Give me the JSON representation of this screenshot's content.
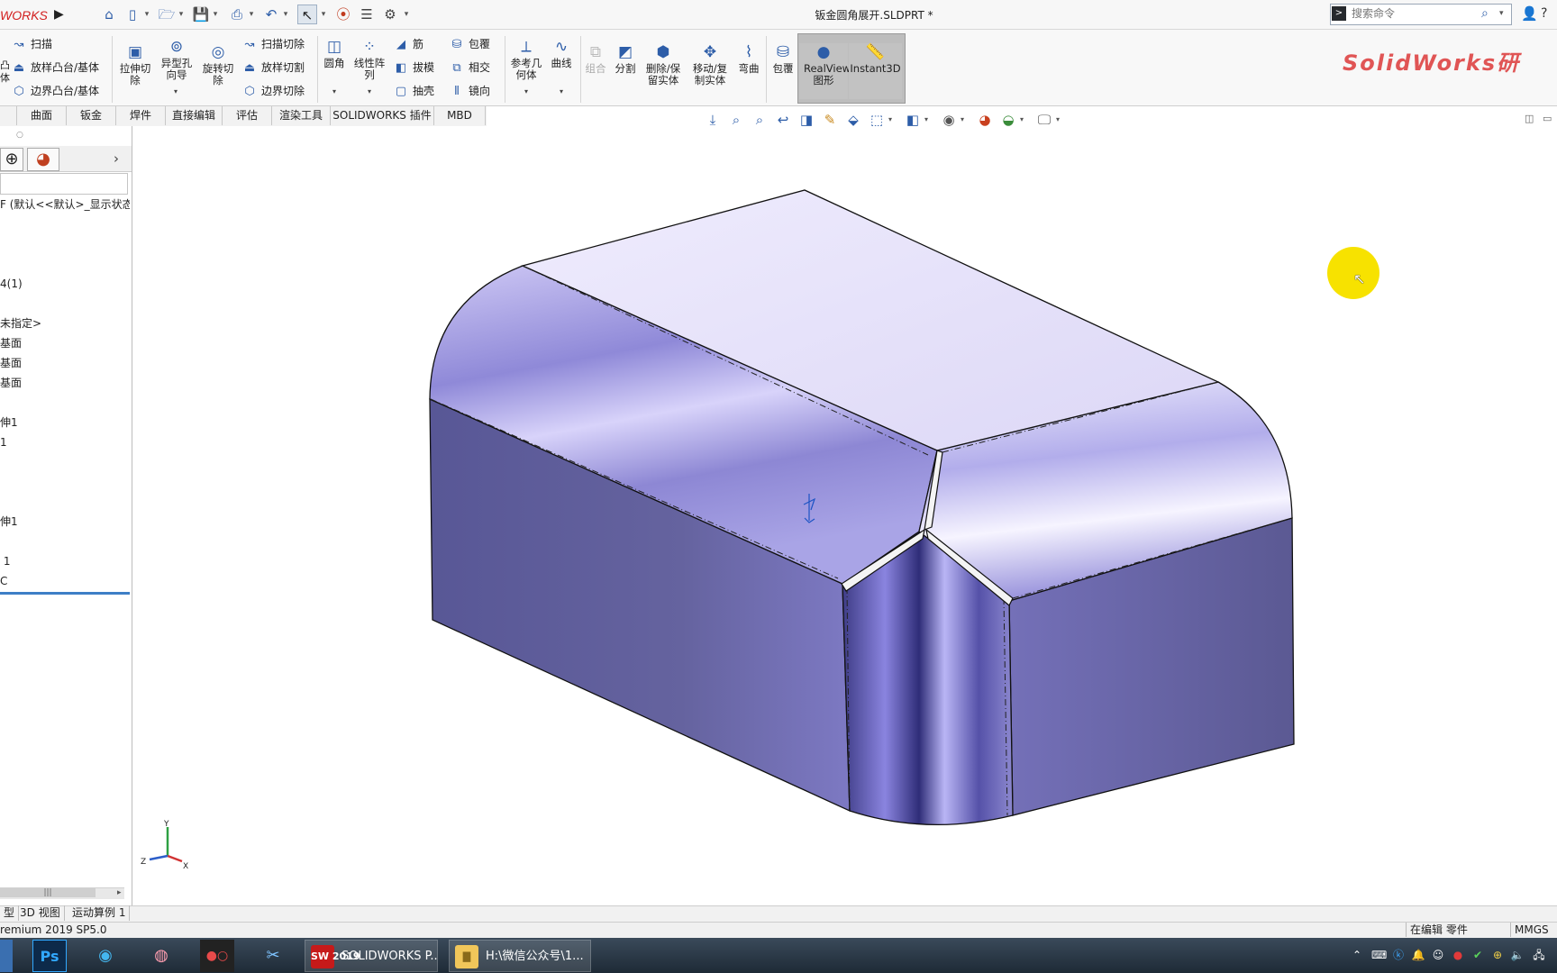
{
  "app": {
    "logo_text": "WORKS",
    "document_title": "钣金圆角展开.SLDPRT *"
  },
  "search": {
    "placeholder": "搜索命令"
  },
  "ribbon": {
    "left_rows": [
      "扫描",
      "放样凸台/基体",
      "边界凸台/基体"
    ],
    "left_prefix": [
      "凸",
      "体"
    ],
    "big_buttons_1": [
      "拉伸切除",
      "异型孔向导",
      "旋转切除"
    ],
    "cut_rows": [
      "扫描切除",
      "放样切割",
      "边界切除"
    ],
    "fillet_button": "圆角",
    "pattern_button": "线性阵列",
    "feature_rows_a": [
      "筋",
      "拔模",
      "抽壳"
    ],
    "feature_rows_b": [
      "包覆",
      "相交",
      "镜向"
    ],
    "ref_geom_button": "参考几何体",
    "curves_button": "曲线",
    "combine_button": "组合",
    "split_button": "分割",
    "delete_keep_button": "删除/保留实体",
    "move_copy_button": "移动/复制实体",
    "flex_button": "弯曲",
    "wrap_button": "包覆",
    "realview_button": "RealView图形",
    "instant3d_button": "Instant3D",
    "brand_text": "SolidWorks研"
  },
  "tabs": [
    "曲面",
    "钣金",
    "焊件",
    "直接编辑",
    "评估",
    "渲染工具",
    "SOLIDWORKS 插件",
    "MBD"
  ],
  "tree": {
    "items": [
      "F (默认<<默认>_显示状态",
      "4(1)",
      "未指定>",
      "基面",
      "基面",
      "基面",
      "伸1",
      "1",
      "伸1",
      " 1",
      "C"
    ]
  },
  "bottom_tabs": [
    "型",
    "3D 视图",
    "运动算例 1"
  ],
  "status": {
    "version": "remium 2019 SP5.0",
    "editing": "在编辑 零件",
    "units": "MMGS"
  },
  "triad": {
    "x": "X",
    "y": "Y",
    "z": "Z"
  },
  "taskbar": {
    "apps": [
      "Ps"
    ],
    "tasks": [
      {
        "badge": "SW 2019",
        "label": "SOLIDWORKS P..."
      },
      {
        "badge": "",
        "label": "H:\\微信公众号\\1..."
      }
    ]
  },
  "colors": {
    "model_light": "#e6e2fb",
    "model_mid": "#7b76c8",
    "model_dark": "#575598",
    "accent": "#2d5da8",
    "logo_red": "#d21f1f"
  }
}
